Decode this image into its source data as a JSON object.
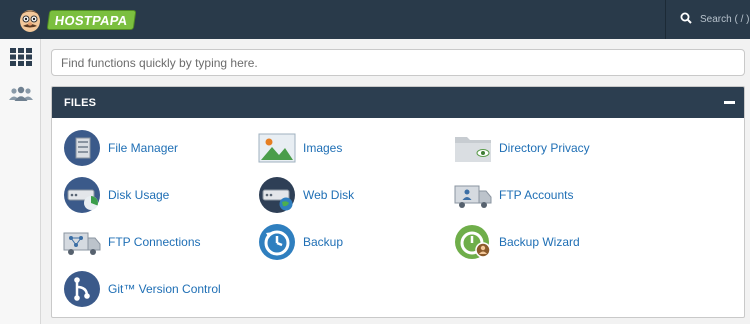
{
  "brand": {
    "logo_text": "HOSTPAPA"
  },
  "top_search": {
    "label": "Search ( / )",
    "icon": "search-icon"
  },
  "rail": {
    "items": [
      {
        "icon": "grid-icon"
      },
      {
        "icon": "users-icon"
      }
    ]
  },
  "quick_search": {
    "placeholder": "Find functions quickly by typing here.",
    "value": ""
  },
  "panel": {
    "title": "FILES",
    "collapse_icon": "minus-icon",
    "items": [
      {
        "label": "File Manager",
        "icon": "file-manager-icon"
      },
      {
        "label": "Images",
        "icon": "images-icon"
      },
      {
        "label": "Directory Privacy",
        "icon": "directory-privacy-icon"
      },
      {
        "label": "Disk Usage",
        "icon": "disk-usage-icon"
      },
      {
        "label": "Web Disk",
        "icon": "web-disk-icon"
      },
      {
        "label": "FTP Accounts",
        "icon": "ftp-accounts-icon"
      },
      {
        "label": "FTP Connections",
        "icon": "ftp-connections-icon"
      },
      {
        "label": "Backup",
        "icon": "backup-icon"
      },
      {
        "label": "Backup Wizard",
        "icon": "backup-wizard-icon"
      },
      {
        "label": "Git™ Version Control",
        "icon": "git-icon"
      }
    ]
  },
  "colors": {
    "topbar": "#293a4a",
    "panel_header": "#2c3e50",
    "link": "#1f6fb5",
    "brand_green": "#7bbf3f"
  }
}
